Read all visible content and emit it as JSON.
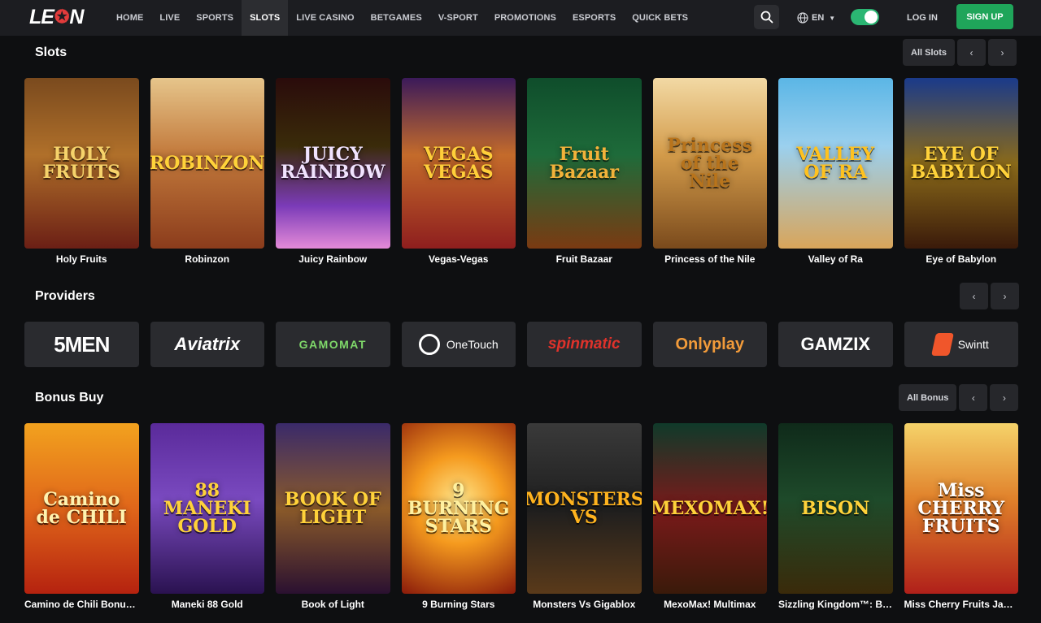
{
  "brand": {
    "logo_left": "LE",
    "logo_right": "N"
  },
  "nav": [
    {
      "label": "HOME"
    },
    {
      "label": "LIVE"
    },
    {
      "label": "SPORTS"
    },
    {
      "label": "SLOTS"
    },
    {
      "label": "LIVE CASINO"
    },
    {
      "label": "BETGAMES"
    },
    {
      "label": "V-SPORT"
    },
    {
      "label": "PROMOTIONS"
    },
    {
      "label": "ESPORTS"
    },
    {
      "label": "QUICK BETS"
    }
  ],
  "header": {
    "language": "EN",
    "login": "LOG IN",
    "signup": "SIGN UP",
    "search_icon": "search-icon",
    "theme_toggle_on": true
  },
  "colors": {
    "accent_green": "#1fa55a",
    "topbar": "#1c1d21",
    "background": "#0e0f11"
  },
  "slots": {
    "title": "Slots",
    "all_label": "All Slots",
    "games": [
      {
        "name": "Holy Fruits",
        "art": "HOLY FRUITS",
        "bg": "linear-gradient(180deg,#7a4a1e 0%,#b0702a 45%,#6b1f15 100%)",
        "fg": "#f6d36b"
      },
      {
        "name": "Robinzon",
        "art": "ROBINZON",
        "bg": "linear-gradient(180deg,#e6c58b 0%,#c2793b 45%,#8b3c1c 100%)",
        "fg": "#ffd23a"
      },
      {
        "name": "Juicy Rainbow",
        "art": "JUICY RAINBOW",
        "bg": "linear-gradient(180deg,#2a0b0b 0%,#3a2b0a 40%,#7b3bb8 75%,#e48ad8 100%)",
        "fg": "#f1e3ff"
      },
      {
        "name": "Vegas-Vegas",
        "art": "VEGAS VEGAS",
        "bg": "linear-gradient(180deg,#3b1a5a 0%,#c46b2b 45%,#8e1e1e 100%)",
        "fg": "#ffcf3a"
      },
      {
        "name": "Fruit Bazaar",
        "art": "Fruit Bazaar",
        "bg": "linear-gradient(180deg,#0f4d2b 0%,#1e6b3a 45%,#7a3a12 100%)",
        "fg": "#f2b23a"
      },
      {
        "name": "Princess of the Nile",
        "art": "Princess of the Nile",
        "bg": "linear-gradient(180deg,#f2d9a4 0%,#d39b4a 45%,#7a4a1c 100%)",
        "fg": "#b8741c"
      },
      {
        "name": "Valley of Ra",
        "art": "VALLEY OF RA",
        "bg": "linear-gradient(180deg,#5bb6e6 0%,#9bd0ee 40%,#d9a55a 100%)",
        "fg": "#ffc21f"
      },
      {
        "name": "Eye of Babylon",
        "art": "EYE OF BABYLON",
        "bg": "linear-gradient(180deg,#1a3a8a 0%,#8a6a1a 50%,#3a1a0a 100%)",
        "fg": "#ffd23a"
      }
    ]
  },
  "providers": {
    "title": "Providers",
    "items": [
      {
        "name": "5MEN",
        "color": "#ffffff",
        "accent": "#e23b3b"
      },
      {
        "name": "Aviatrix",
        "color": "#ffffff",
        "accent": "#ffffff"
      },
      {
        "name": "GAMOMAT",
        "color": "#7fd96a",
        "accent": "#7fd96a"
      },
      {
        "name": "OneTouch",
        "color": "#ffffff",
        "accent": "#ffffff"
      },
      {
        "name": "spinmatic",
        "color": "#e0322b",
        "accent": "#e0322b"
      },
      {
        "name": "Onlyplay",
        "color": "#f29b3a",
        "accent": "#c95fd6"
      },
      {
        "name": "GAMZIX",
        "color": "#ffffff",
        "accent": "#ffffff"
      },
      {
        "name": "Swintt",
        "color": "#ffffff",
        "accent": "#f0562b"
      }
    ]
  },
  "bonus": {
    "title": "Bonus Buy",
    "all_label": "All Bonus",
    "games": [
      {
        "name": "Camino de Chili Bonus …",
        "art": "Camino de CHILI",
        "bg": "linear-gradient(180deg,#f2a21e 0%,#e0661a 50%,#b5220f 100%)",
        "fg": "#fff3b0"
      },
      {
        "name": "Maneki 88 Gold",
        "art": "88 MANEKI GOLD",
        "bg": "linear-gradient(180deg,#5a2a9a 0%,#7a4ac0 45%,#2a1250 100%)",
        "fg": "#ffd23a"
      },
      {
        "name": "Book of Light",
        "art": "BOOK OF LIGHT",
        "bg": "linear-gradient(180deg,#3a2a6a 0%,#8a5a2a 50%,#2a1030 100%)",
        "fg": "#ffd23a"
      },
      {
        "name": "9 Burning Stars",
        "art": "9 BURNING STARS",
        "bg": "radial-gradient(circle at 50% 45%,#ffe58a 0%,#f59a1e 40%,#8a1a0a 100%)",
        "fg": "#fff1a0"
      },
      {
        "name": "Monsters Vs Gigablox",
        "art": "MONSTERS VS",
        "bg": "linear-gradient(180deg,#3a3a3a 0%,#1e1e1e 50%,#5a3a1a 100%)",
        "fg": "#ffb31e"
      },
      {
        "name": "MexoMax! Multimax",
        "art": "MEXOMAX!",
        "bg": "linear-gradient(180deg,#0f3a2a 0%,#7a1a1a 50%,#3a1a0a 100%)",
        "fg": "#ffd23a"
      },
      {
        "name": "Sizzling Kingdom™: Bis…",
        "art": "BISON",
        "bg": "linear-gradient(180deg,#0f2a1a 0%,#1e4a2a 45%,#3a2a0a 100%)",
        "fg": "#ffd23a"
      },
      {
        "name": "Miss Cherry Fruits Jack…",
        "art": "Miss CHERRY FRUITS",
        "bg": "linear-gradient(180deg,#f5d36a 0%,#e0802a 45%,#b0201a 100%)",
        "fg": "#ffffff"
      }
    ]
  }
}
